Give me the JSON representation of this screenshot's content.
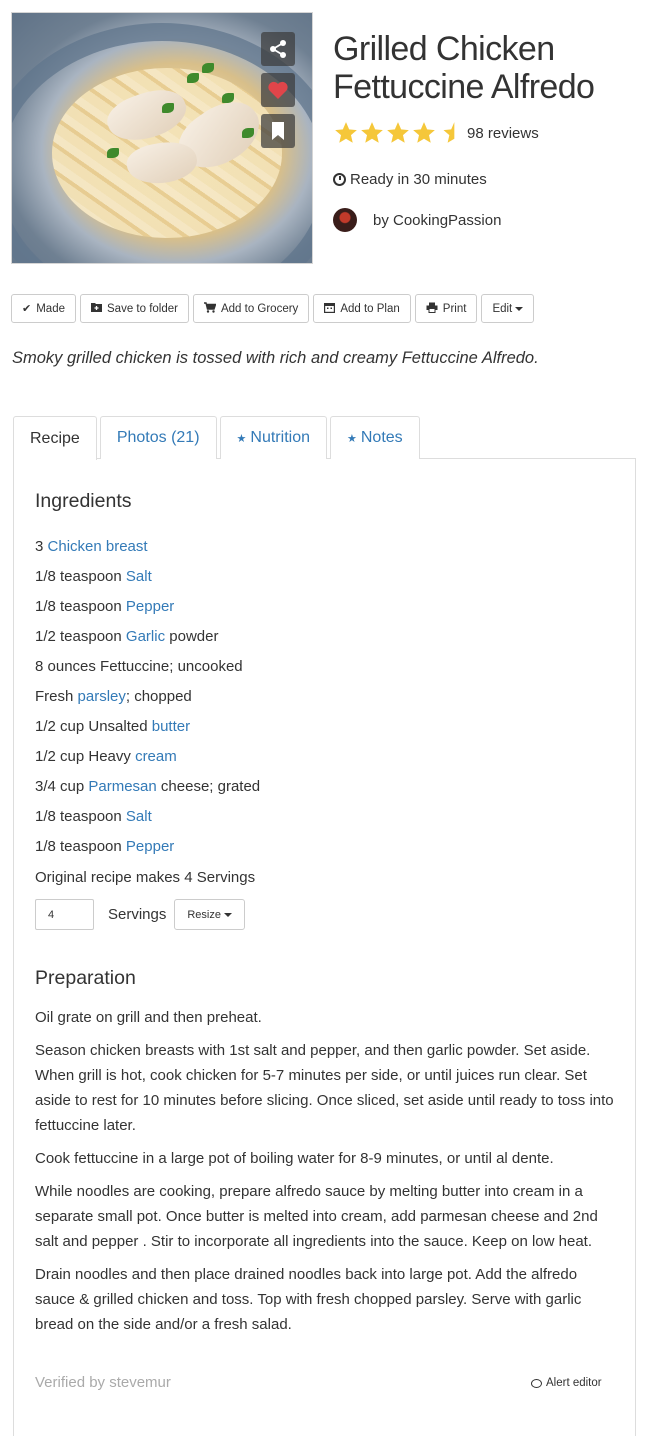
{
  "recipe": {
    "title": "Grilled Chicken Fettuccine Alfredo",
    "reviews": "98 reviews",
    "rating": 4.5,
    "ready": "Ready in 30 minutes",
    "author": "by CookingPassion",
    "description": "Smoky grilled chicken is tossed with rich and creamy Fettuccine Alfredo."
  },
  "photo_actions": [
    "share-icon",
    "heart-icon",
    "bookmark-icon"
  ],
  "toolbar": {
    "made": "Made",
    "save": "Save to folder",
    "grocery": "Add to Grocery",
    "plan": "Add to Plan",
    "print": "Print",
    "edit": "Edit"
  },
  "tabs": {
    "recipe": "Recipe",
    "photos": "Photos (21)",
    "nutrition": "Nutrition",
    "notes": "Notes"
  },
  "ingredients": {
    "heading": "Ingredients",
    "items": [
      {
        "pre": "3 ",
        "link": "Chicken breast",
        "post": ""
      },
      {
        "pre": "1/8 teaspoon ",
        "link": "Salt",
        "post": ""
      },
      {
        "pre": "1/8 teaspoon ",
        "link": "Pepper",
        "post": ""
      },
      {
        "pre": "1/2 teaspoon ",
        "link": "Garlic",
        "post": " powder"
      },
      {
        "pre": "8 ounces Fettuccine; uncooked",
        "link": "",
        "post": ""
      },
      {
        "pre": "Fresh ",
        "link": "parsley",
        "post": "; chopped"
      },
      {
        "pre": "1/2 cup Unsalted ",
        "link": "butter",
        "post": ""
      },
      {
        "pre": "1/2 cup Heavy ",
        "link": "cream",
        "post": ""
      },
      {
        "pre": "3/4 cup ",
        "link": "Parmesan",
        "post": " cheese; grated"
      },
      {
        "pre": "1/8 teaspoon ",
        "link": "Salt",
        "post": ""
      },
      {
        "pre": "1/8 teaspoon ",
        "link": "Pepper",
        "post": ""
      }
    ],
    "original": "Original recipe makes 4 Servings",
    "servings_value": "4",
    "servings_label": "Servings",
    "resize": "Resize"
  },
  "preparation": {
    "heading": "Preparation",
    "steps": [
      "Oil grate on grill and then preheat.",
      "Season chicken breasts with 1st salt and pepper, and then garlic powder. Set aside. When grill is hot, cook chicken for 5-7 minutes per side, or until juices run clear. Set aside to rest for 10 minutes before slicing. Once sliced, set aside until ready to toss into fettuccine later.",
      "Cook fettuccine in a large pot of boiling water for 8-9 minutes, or until al dente.",
      "While noodles are cooking, prepare alfredo sauce by melting butter into cream in a separate small pot. Once butter is melted into cream, add parmesan cheese and 2nd salt and pepper . Stir to incorporate all ingredients into the sauce. Keep on low heat.",
      "Drain noodles and then place drained noodles back into large pot. Add the alfredo sauce & grilled chicken and toss. Top with fresh chopped parsley. Serve with garlic bread on the side and/or a fresh salad."
    ]
  },
  "footer": {
    "verified": "Verified by stevemur",
    "alert": "Alert editor"
  },
  "colors": {
    "link": "#337ab7",
    "star": "#f5c73a",
    "heart": "#e0454a"
  }
}
